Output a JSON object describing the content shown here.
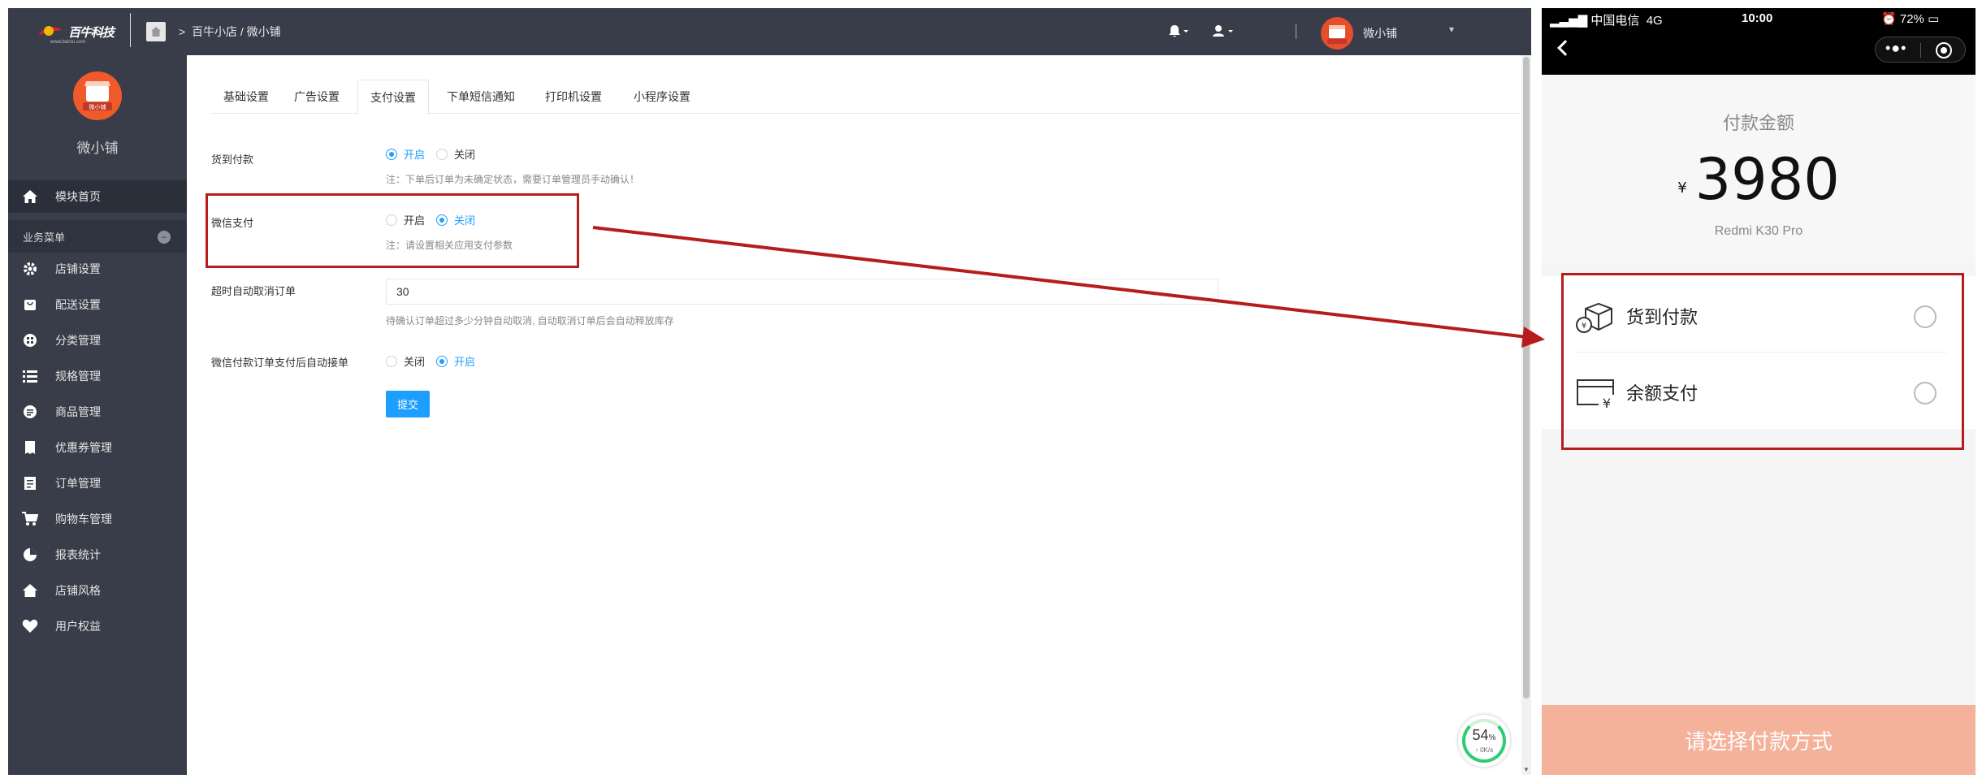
{
  "admin": {
    "logo_text": "百牛科技",
    "logo_sub": "www.bainiu.com",
    "breadcrumb": "百牛小店 / 微小铺",
    "topbar_user": "微小铺",
    "sidebar": {
      "shop_name": "微小铺",
      "home_item": "模块首页",
      "section_header": "业务菜单",
      "items": [
        {
          "label": "店铺设置",
          "icon": "gear-icon"
        },
        {
          "label": "配送设置",
          "icon": "bag-icon"
        },
        {
          "label": "分类管理",
          "icon": "grid-icon"
        },
        {
          "label": "规格管理",
          "icon": "list-icon"
        },
        {
          "label": "商品管理",
          "icon": "goods-icon"
        },
        {
          "label": "优惠券管理",
          "icon": "coupon-icon"
        },
        {
          "label": "订单管理",
          "icon": "order-icon"
        },
        {
          "label": "购物车管理",
          "icon": "cart-icon"
        },
        {
          "label": "报表统计",
          "icon": "pie-icon"
        },
        {
          "label": "店铺风格",
          "icon": "home-icon"
        },
        {
          "label": "用户权益",
          "icon": "heart-icon"
        }
      ]
    },
    "tabs": [
      "基础设置",
      "广告设置",
      "支付设置",
      "下单短信通知",
      "打印机设置",
      "小程序设置"
    ],
    "active_tab": "支付设置",
    "form": {
      "cod": {
        "label": "货到付款",
        "opt_on": "开启",
        "opt_off": "关闭",
        "hint": "注：下单后订单为未确定状态，需要订单管理员手动确认！"
      },
      "wechat": {
        "label": "微信支付",
        "opt_on": "开启",
        "opt_off": "关闭",
        "hint": "注：请设置相关应用支付参数"
      },
      "timeout": {
        "label": "超时自动取消订单",
        "value": "30",
        "hint": "待确认订单超过多少分钟自动取消, 自动取消订单后会自动释放库存"
      },
      "auto_accept": {
        "label": "微信付款订单支付后自动接单",
        "opt_off": "关闭",
        "opt_on": "开启"
      },
      "submit": "提交"
    },
    "speed_widget": {
      "percent": "54",
      "unit": "%",
      "net": "0K/s"
    }
  },
  "phone": {
    "status": {
      "carrier": "中国电信",
      "network": "4G",
      "time": "10:00",
      "battery": "72%"
    },
    "pay_title": "付款金额",
    "currency": "¥",
    "amount": "3980",
    "product": "Redmi K30 Pro",
    "options": [
      {
        "label": "货到付款",
        "icon": "package-icon"
      },
      {
        "label": "余额支付",
        "icon": "wallet-icon"
      }
    ],
    "footer_button": "请选择付款方式"
  },
  "colors": {
    "admin_dark": "#393d49",
    "accent_blue": "#1e9fff",
    "highlight_red": "#b71c1c",
    "footer_salmon": "#f4b29b"
  }
}
